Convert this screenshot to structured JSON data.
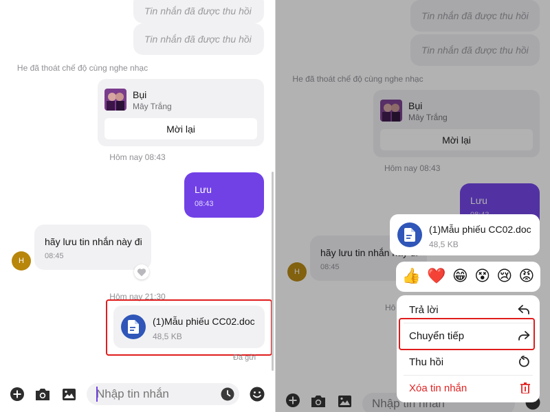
{
  "conversation": {
    "recalled_text": "Tin nhắn đã được thu hồi",
    "system_music_left": "He đã thoát chế độ cùng nghe nhạc",
    "music_card": {
      "title": "Bụi",
      "artist": "Mây Trắng",
      "reinvite_label": "Mời lại"
    },
    "timestamp_1": "Hôm nay 08:43",
    "sent_message": {
      "text": "Lưu",
      "time": "08:43"
    },
    "received_message": {
      "avatar_initial": "H",
      "text": "hãy lưu tin nhắn này đi",
      "time": "08:45"
    },
    "timestamp_2": "Hôm nay 21:30",
    "file_message": {
      "name": "(1)Mẫu phiếu CC02.doc",
      "size": "48,5 KB",
      "status": "Đã gửi"
    }
  },
  "input_bar": {
    "placeholder": "Nhập tin nhắn"
  },
  "context_menu": {
    "reactions": [
      "👍",
      "❤️",
      "😁",
      "😵",
      "😢",
      "😡"
    ],
    "items": [
      {
        "label": "Trả lời",
        "icon": "reply-icon"
      },
      {
        "label": "Chuyển tiếp",
        "icon": "forward-icon"
      },
      {
        "label": "Thu hồi",
        "icon": "recall-icon"
      },
      {
        "label": "Xóa tin nhắn",
        "icon": "trash-icon"
      }
    ]
  },
  "colors": {
    "accent": "#7141e6",
    "file_icon": "#2f56b8",
    "highlight": "#e01b1b",
    "danger": "#e02424",
    "avatar": "#b8860b"
  }
}
